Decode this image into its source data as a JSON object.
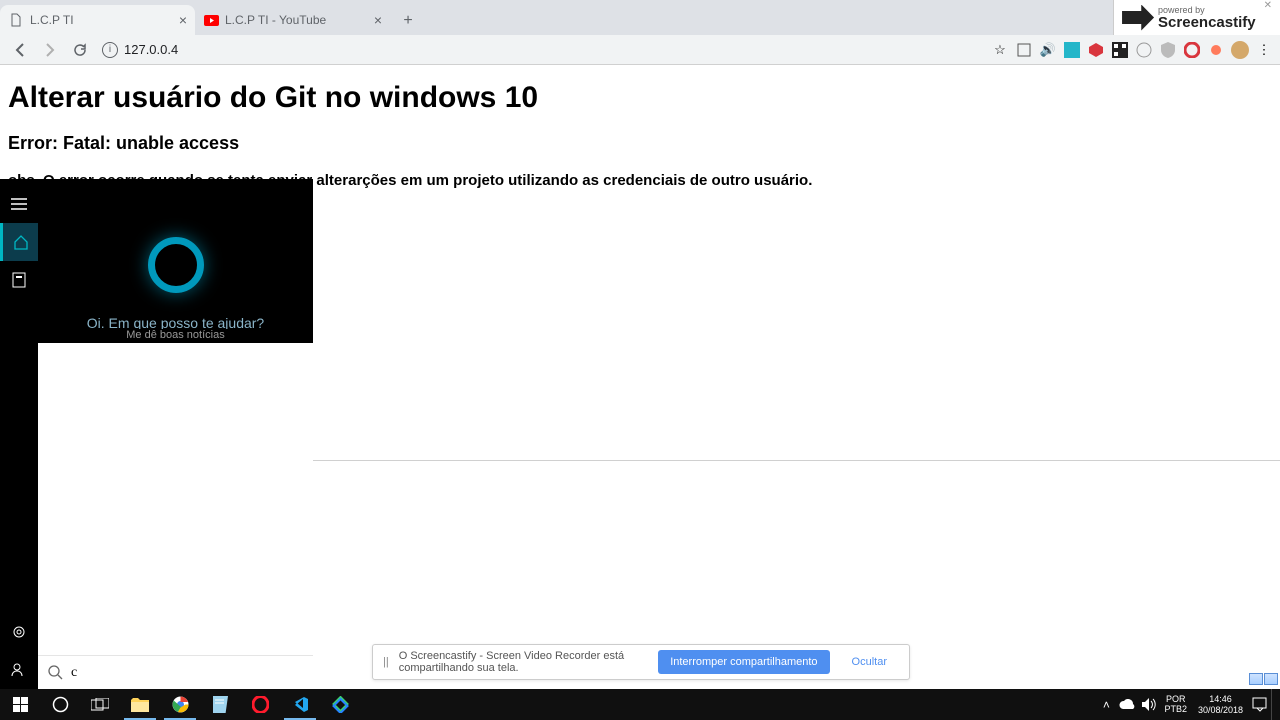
{
  "browser": {
    "tabs": [
      {
        "title": "L.C.P TI",
        "favicon": "file"
      },
      {
        "title": "L.C.P TI - YouTube",
        "favicon": "youtube"
      }
    ],
    "url": "127.0.0.4",
    "star": "☆"
  },
  "screencastify_badge": {
    "top": "powered by",
    "name": "Screencastify"
  },
  "page": {
    "h1": "Alterar usuário do Git no windows 10",
    "h2": "Error: Fatal: unable access",
    "p": "obs. O error ocorre quando se tenta enviar alterarções em um projeto utilizando as credenciais de outro usuário."
  },
  "cortana": {
    "greeting": "Oi. Em que posso te ajudar?",
    "suggestion": "Me dê boas notícias",
    "search_value": "c"
  },
  "notif": {
    "text": "O Screencastify - Screen Video Recorder está compartilhando sua tela.",
    "primary": "Interromper compartilhamento",
    "secondary": "Ocultar"
  },
  "system": {
    "lang1": "POR",
    "lang2": "PTB2",
    "time": "14:46",
    "date": "30/08/2018"
  }
}
